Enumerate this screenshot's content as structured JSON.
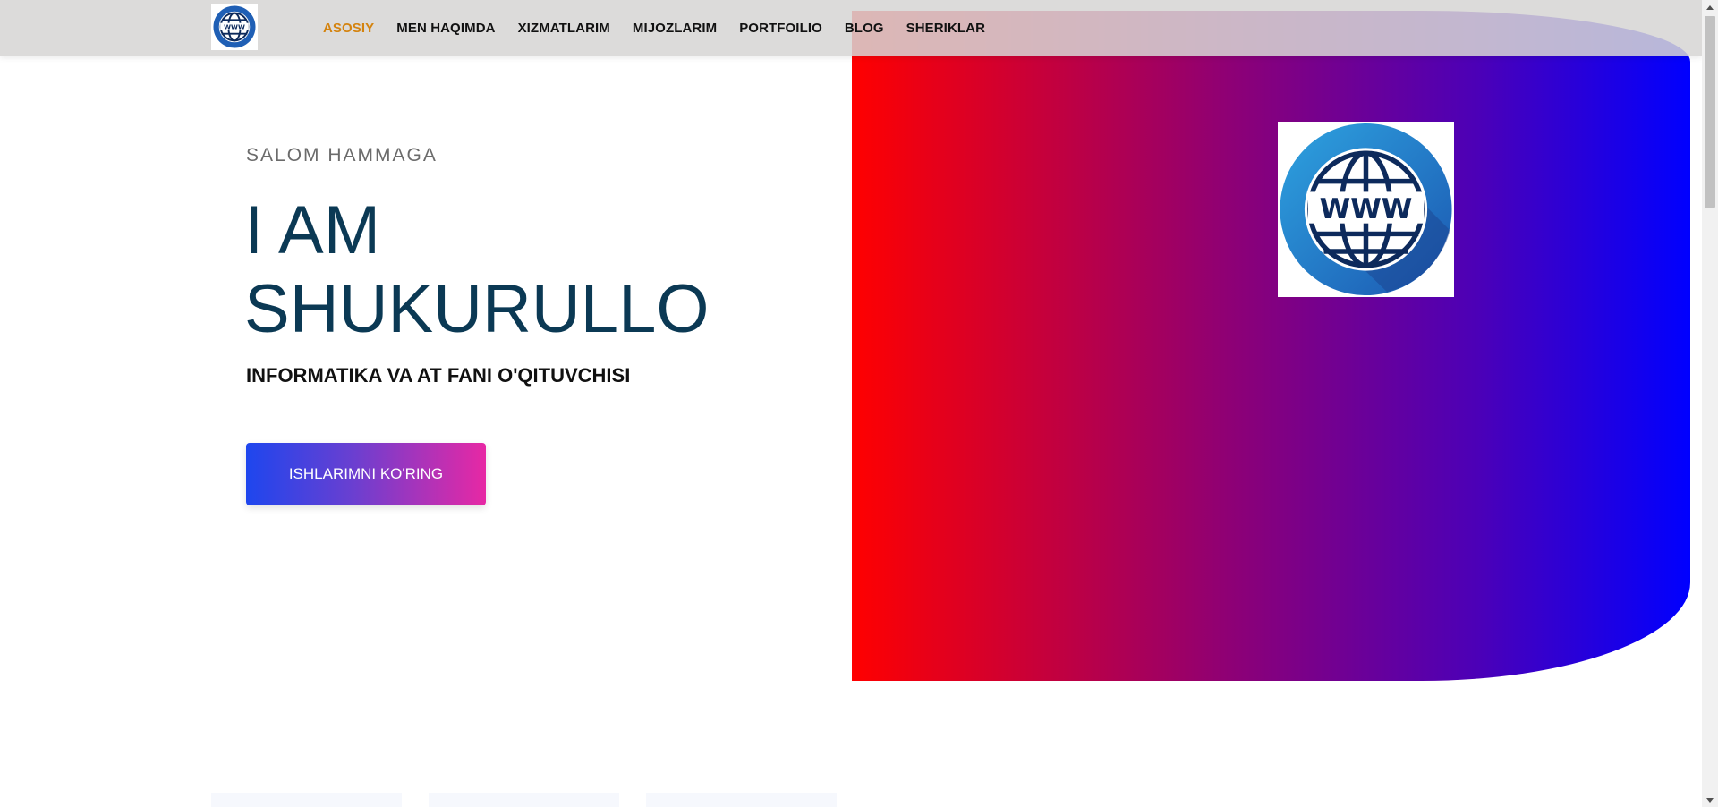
{
  "header": {
    "nav": [
      {
        "label": "ASOSIY",
        "active": true
      },
      {
        "label": "MEN HAQIMDA",
        "active": false
      },
      {
        "label": "XIZMATLARIM",
        "active": false
      },
      {
        "label": "MIJOZLARIM",
        "active": false
      },
      {
        "label": "PORTFOILIO",
        "active": false
      },
      {
        "label": "BLOG",
        "active": false
      },
      {
        "label": "SHERIKLAR",
        "active": false
      }
    ],
    "logo_icon": "www-globe-icon"
  },
  "hero": {
    "greeting": "SALOM HAMMAGA",
    "title_line1": "I AM",
    "title_line2": "SHUKURULLO",
    "subtitle": "INFORMATIKA VA AT FANI O'QITUVCHISI",
    "cta_label": "ISHLARIMNI KO'RING",
    "image_icon": "www-globe-icon"
  },
  "colors": {
    "active_nav": "#d4830f",
    "title": "#0b3954",
    "panel_gradient": [
      "#ff0000",
      "#0000ff"
    ],
    "button_gradient": [
      "#1e46ee",
      "#e728a4"
    ]
  }
}
